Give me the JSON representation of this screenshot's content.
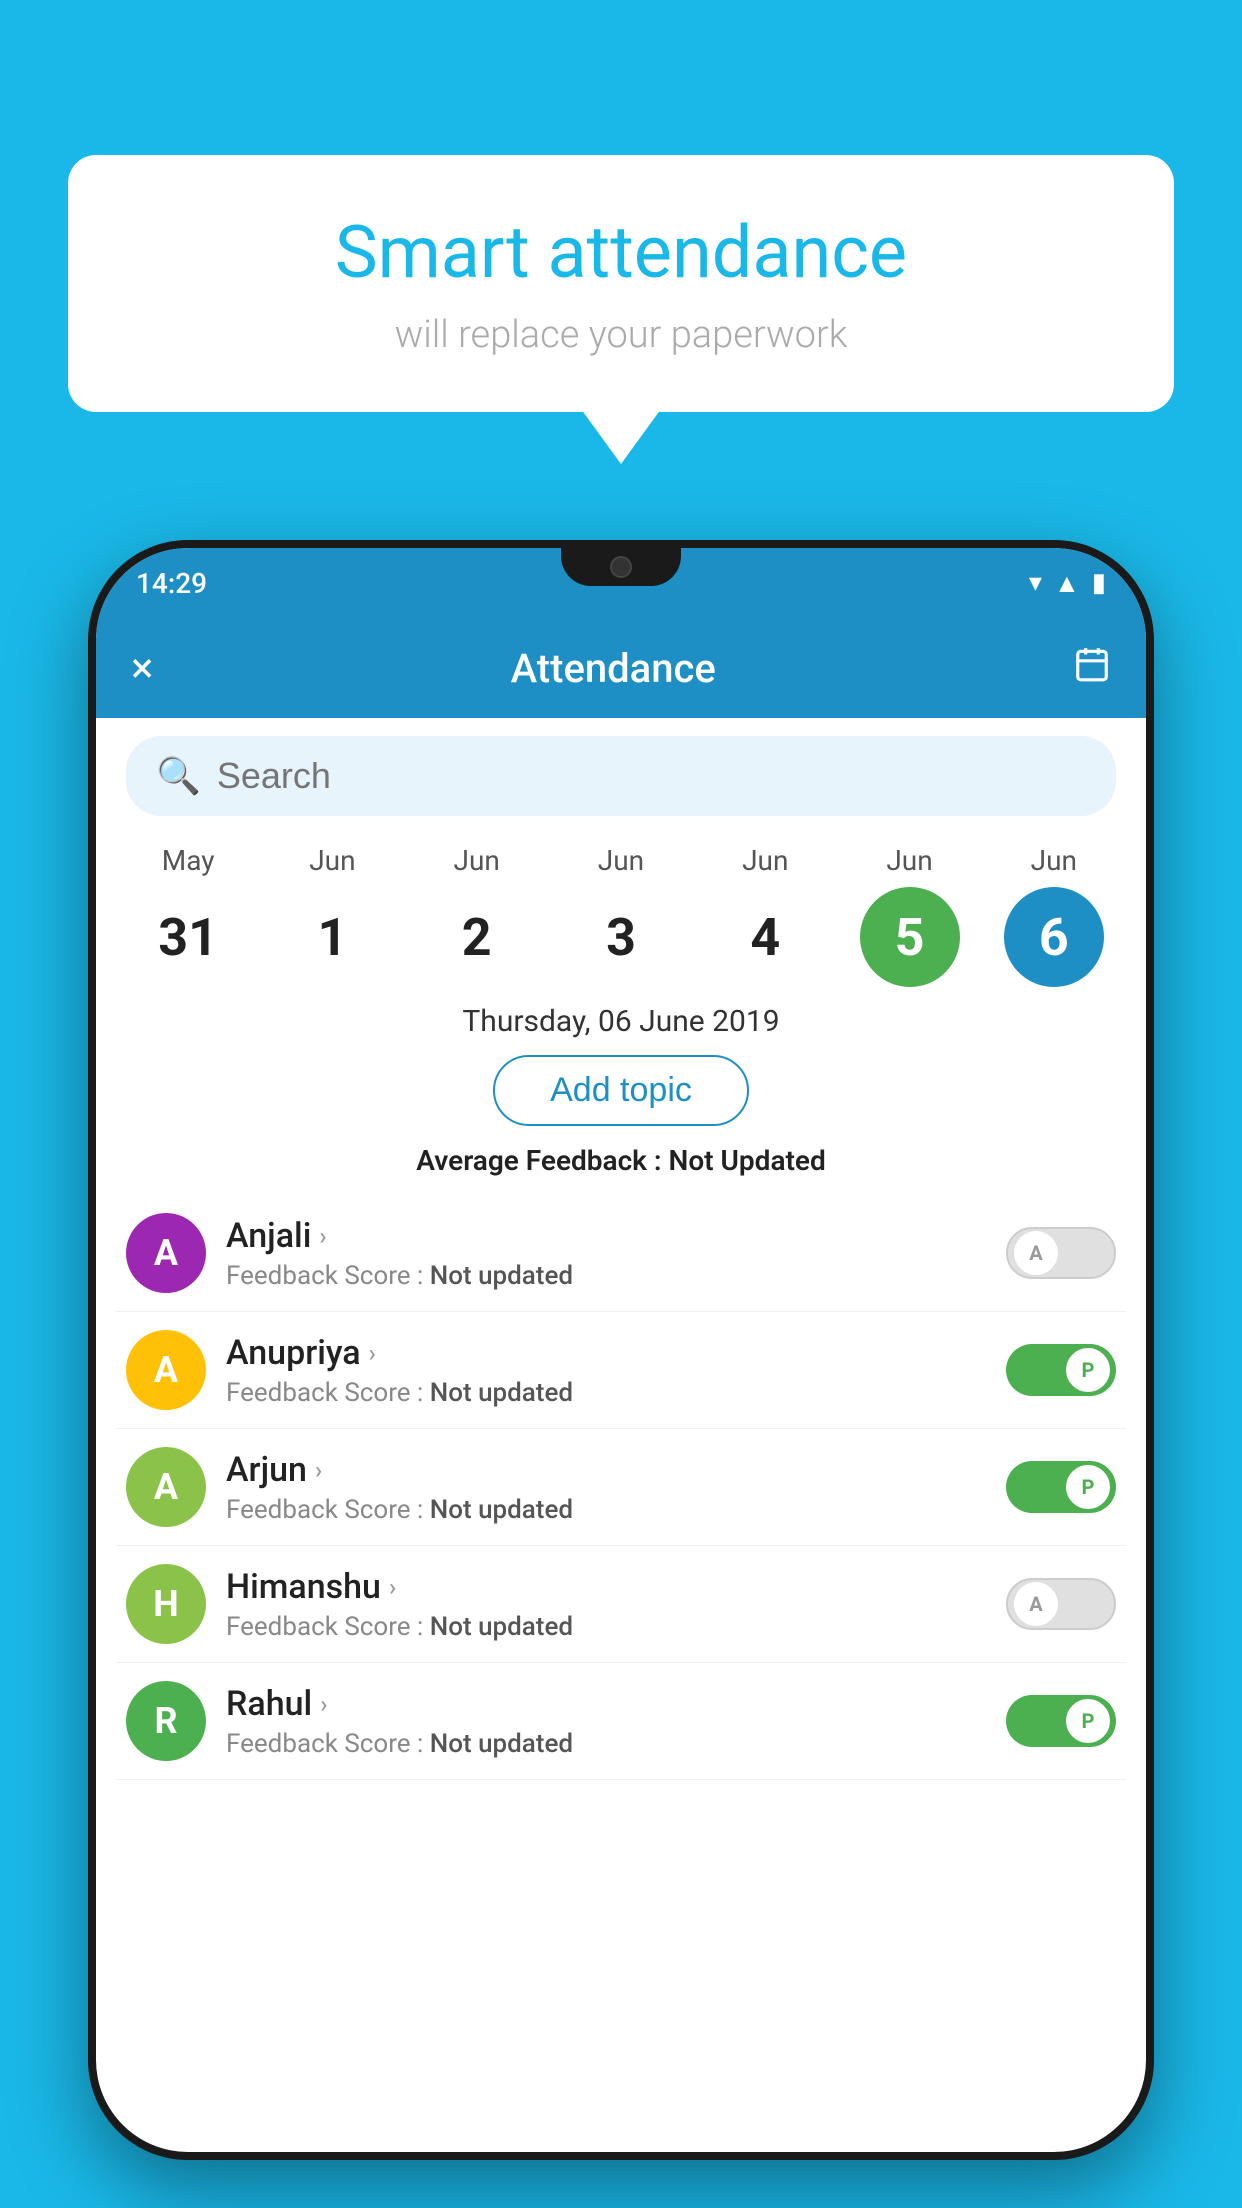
{
  "background_color": "#1ab8e8",
  "bubble": {
    "title": "Smart attendance",
    "subtitle": "will replace your paperwork"
  },
  "phone": {
    "status_bar": {
      "time": "14:29",
      "icons": [
        "wifi",
        "signal",
        "battery"
      ]
    },
    "app_bar": {
      "close_label": "×",
      "title": "Attendance",
      "calendar_icon": "📅"
    },
    "search": {
      "placeholder": "Search"
    },
    "calendar": {
      "days": [
        {
          "month": "May",
          "date": "31",
          "state": "normal"
        },
        {
          "month": "Jun",
          "date": "1",
          "state": "normal"
        },
        {
          "month": "Jun",
          "date": "2",
          "state": "normal"
        },
        {
          "month": "Jun",
          "date": "3",
          "state": "normal"
        },
        {
          "month": "Jun",
          "date": "4",
          "state": "normal"
        },
        {
          "month": "Jun",
          "date": "5",
          "state": "today"
        },
        {
          "month": "Jun",
          "date": "6",
          "state": "selected"
        }
      ]
    },
    "selected_date_label": "Thursday, 06 June 2019",
    "add_topic_label": "Add topic",
    "avg_feedback_label": "Average Feedback : ",
    "avg_feedback_value": "Not Updated",
    "students": [
      {
        "name": "Anjali",
        "feedback_label": "Feedback Score : ",
        "feedback_value": "Not updated",
        "avatar_letter": "A",
        "avatar_color": "#9c27b0",
        "status": "absent"
      },
      {
        "name": "Anupriya",
        "feedback_label": "Feedback Score : ",
        "feedback_value": "Not updated",
        "avatar_letter": "A",
        "avatar_color": "#ffc107",
        "status": "present"
      },
      {
        "name": "Arjun",
        "feedback_label": "Feedback Score : ",
        "feedback_value": "Not updated",
        "avatar_letter": "A",
        "avatar_color": "#8bc34a",
        "status": "present"
      },
      {
        "name": "Himanshu",
        "feedback_label": "Feedback Score : ",
        "feedback_value": "Not updated",
        "avatar_letter": "H",
        "avatar_color": "#8bc34a",
        "status": "absent"
      },
      {
        "name": "Rahul",
        "feedback_label": "Feedback Score : ",
        "feedback_value": "Not updated",
        "avatar_letter": "R",
        "avatar_color": "#4caf50",
        "status": "present"
      }
    ]
  }
}
